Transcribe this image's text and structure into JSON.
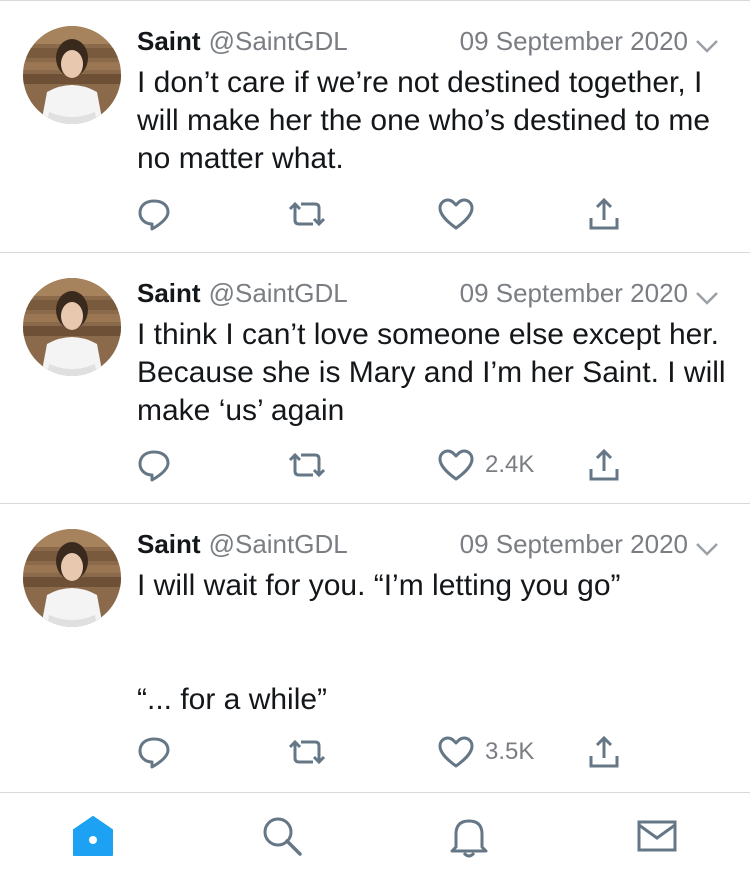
{
  "tweets": [
    {
      "name": "Saint",
      "handle": "@SaintGDL",
      "date": "09 September 2020",
      "text": "I don’t care if we’re not destined together, I will make her the one who’s destined to me no matter what.",
      "likes": ""
    },
    {
      "name": "Saint",
      "handle": "@SaintGDL",
      "date": "09 September 2020",
      "text": "I think I can’t love someone else except her. Because she is Mary and I’m her Saint. I will make ‘us’ again",
      "likes": "2.4K"
    },
    {
      "name": "Saint",
      "handle": "@SaintGDL",
      "date": "09 September 2020",
      "text": "I will wait for you. “I’m letting you go”\n\n\n“... for a while”",
      "likes": "3.5K"
    }
  ],
  "tabbar": {
    "items": [
      "home-icon",
      "search-icon",
      "notifications-icon",
      "messages-icon"
    ],
    "active": "home-icon"
  },
  "colors": {
    "accent": "#1da1f2",
    "icon_gray": "#657786",
    "text_gray": "#7a7e83"
  }
}
